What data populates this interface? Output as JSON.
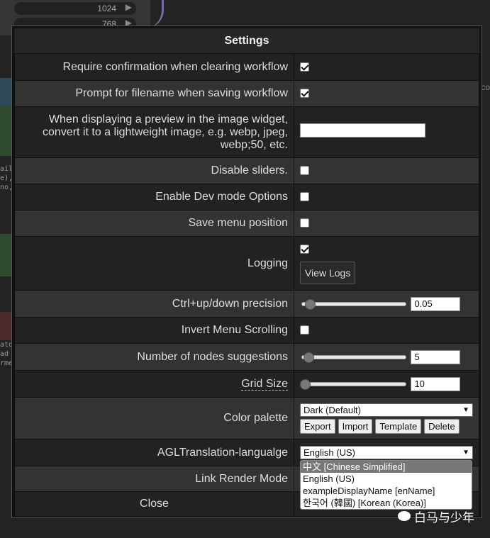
{
  "background": {
    "widgets": [
      {
        "value": "1024"
      },
      {
        "value": "768"
      }
    ],
    "code_snippet_1": "ail\ne),\nno,",
    "code_snippet_2": "ato\nad\nrme",
    "right_fragment": "co"
  },
  "dialog": {
    "title": "Settings",
    "rows": [
      {
        "label": "Require confirmation when clearing workflow",
        "checked": true
      },
      {
        "label": "Prompt for filename when saving workflow",
        "checked": true
      },
      {
        "label": "When displaying a preview in the image widget, convert it to a lightweight image, e.g. webp, jpeg, webp;50, etc.",
        "value": ""
      },
      {
        "label": "Disable sliders.",
        "checked": false
      },
      {
        "label": "Enable Dev mode Options",
        "checked": false
      },
      {
        "label": "Save menu position",
        "checked": false
      },
      {
        "label": "Logging",
        "checked": true,
        "button": "View Logs"
      },
      {
        "label": "Ctrl+up/down precision",
        "value": "0.05",
        "slider_fraction": 0.05
      },
      {
        "label": "Invert Menu Scrolling",
        "checked": false
      },
      {
        "label": "Number of nodes suggestions",
        "value": "5",
        "slider_fraction": 0.04
      },
      {
        "label": "Grid Size",
        "value": "10",
        "slider_fraction": 0.0
      },
      {
        "label": "Color palette",
        "selected": "Dark (Default)",
        "buttons": [
          "Export",
          "Import",
          "Template",
          "Delete"
        ]
      },
      {
        "label": "AGLTranslation-langualge",
        "selected": "English (US)"
      },
      {
        "label": "Link Render Mode"
      }
    ],
    "close_label": "Close"
  },
  "language_dropdown": {
    "options": [
      "中文 [Chinese Simplified]",
      "English (US)",
      "exampleDisplayName [enName]",
      "한국어 (韓國) [Korean (Korea)]"
    ],
    "highlighted_index": 0
  },
  "watermark": {
    "text": "白马与少年"
  }
}
